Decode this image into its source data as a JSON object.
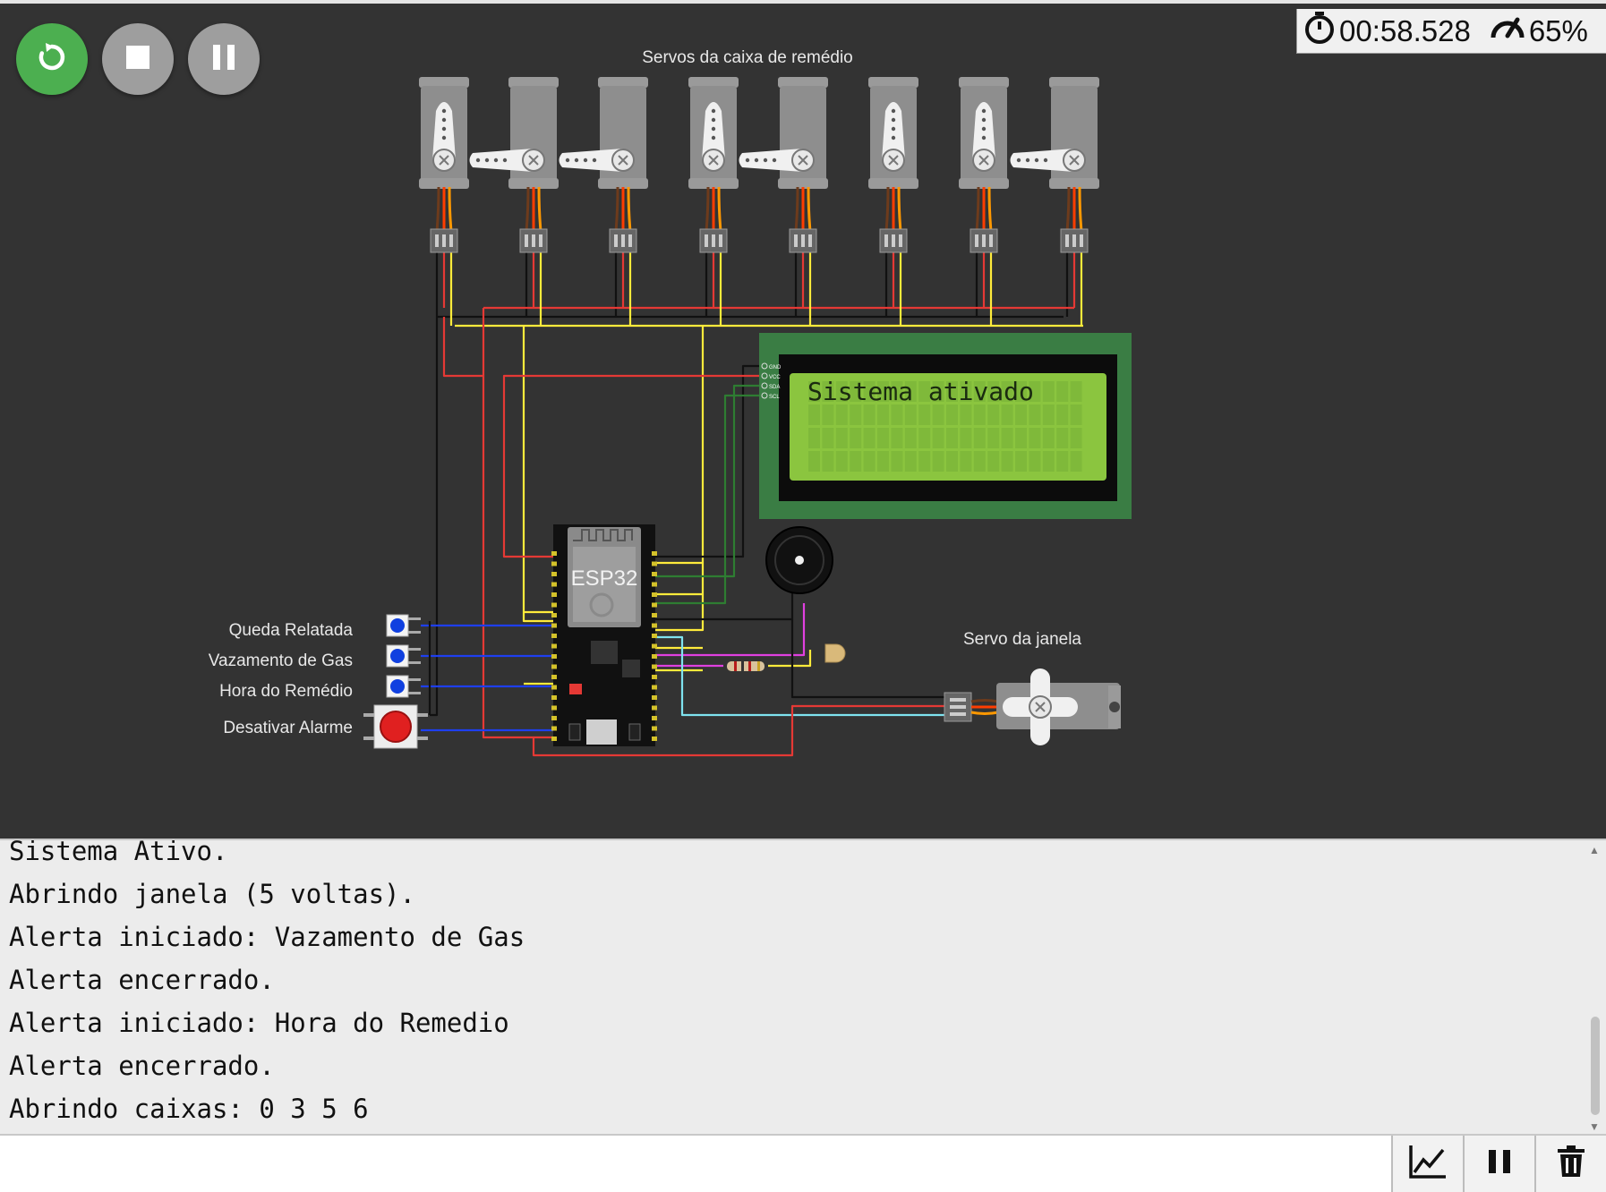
{
  "toolbar": {
    "buttons": [
      {
        "icon": "restart-icon",
        "color": "#4caf50"
      },
      {
        "icon": "stop-icon",
        "color": "#9e9e9e"
      },
      {
        "icon": "pause-icon",
        "color": "#9e9e9e"
      }
    ]
  },
  "status": {
    "time": "00:58.528",
    "speed": "65%"
  },
  "circuit": {
    "servo_group_label": "Servos da caixa de remédio",
    "window_servo_label": "Servo da janela",
    "lcd": {
      "line1": "Sistema ativado",
      "line2": "",
      "pins": [
        "GND",
        "VCC",
        "SDA",
        "SCL"
      ]
    },
    "board_label": "ESP32",
    "buttons": [
      {
        "label": "Queda Relatada",
        "color": "#1040e0"
      },
      {
        "label": "Vazamento de Gas",
        "color": "#1040e0"
      },
      {
        "label": "Hora do Remédio",
        "color": "#1040e0"
      },
      {
        "label": "Desativar Alarme",
        "color": "#e02020"
      }
    ],
    "servo_horn_orientation": [
      "up",
      "left",
      "left",
      "up",
      "left",
      "up",
      "up",
      "left"
    ]
  },
  "serial_monitor": {
    "lines": [
      "Sistema Ativo.",
      "Abrindo janela (5 voltas).",
      "Alerta iniciado: Vazamento de Gas",
      "Alerta encerrado.",
      "Alerta iniciado: Hora do Remedio",
      "Alerta encerrado.",
      "Abrindo caixas: 0 3 5 6"
    ],
    "input_value": ""
  },
  "bottom_toolbar": {
    "buttons": [
      "chart-icon",
      "pause-icon",
      "trash-icon"
    ]
  },
  "colors": {
    "canvas": "#333333",
    "lcd_board": "#3a7d44",
    "lcd_screen": "#8bc53f",
    "wire_red": "#e53935",
    "wire_black": "#111111",
    "wire_yellow": "#ffeb3b",
    "wire_blue": "#1e3ff0",
    "wire_green": "#2e7d32",
    "wire_cyan": "#7fe3ef",
    "wire_magenta": "#e040e0"
  }
}
